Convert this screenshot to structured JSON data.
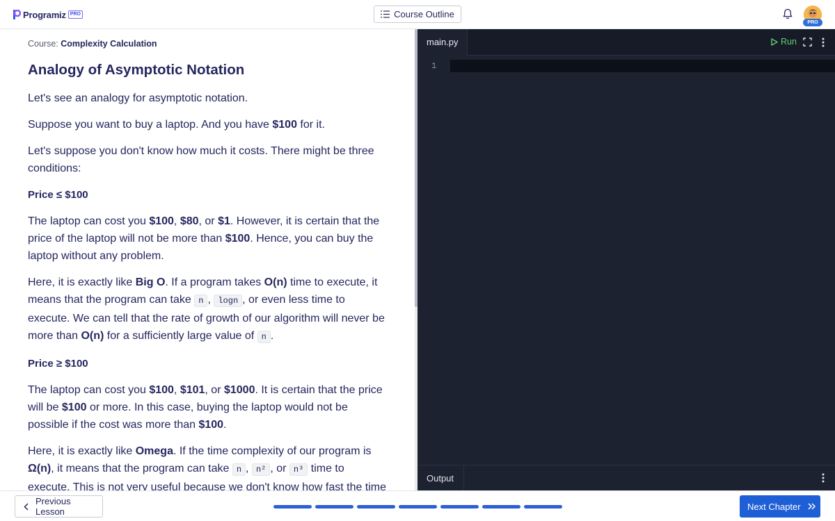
{
  "header": {
    "logo_text": "Programiz",
    "logo_badge": "PRO",
    "outline_label": "Course Outline",
    "avatar_badge": "PRO"
  },
  "lesson": {
    "course_prefix": "Course: ",
    "course_name": "Complexity Calculation",
    "title": "Analogy of Asymptotic Notation",
    "p1": "Let's see an analogy for asymptotic notation.",
    "p2_a": "Suppose you want to buy a laptop. And you have ",
    "p2_b": "$100",
    "p2_c": " for it.",
    "p3": "Let's suppose you don't know how much it costs. There might be three conditions:",
    "h_le": "Price ≤ $100",
    "p4": {
      "a": "The laptop can cost you ",
      "b": "$100",
      "c": ", ",
      "d": "$80",
      "e": ", or ",
      "f": "$1",
      "g": ". However, it is certain that the price of the laptop will not be more than ",
      "h": "$100",
      "i": ". Hence, you can buy the laptop without any problem."
    },
    "p5": {
      "a": "Here, it is exactly like ",
      "b": "Big O",
      "c": ". If a program takes ",
      "d": "O(n)",
      "e": " time to execute, it means that the program can take ",
      "code1": "n",
      "f": ", ",
      "code2": "logn",
      "g": ", or even less time to execute. We can tell that the rate of growth of our algorithm will never be more than ",
      "h": "O(n)",
      "i": " for a sufficiently large value of ",
      "code3": "n",
      "j": "."
    },
    "h_ge": "Price ≥ $100",
    "p6": {
      "a": "The laptop can cost you ",
      "b": "$100",
      "c": ", ",
      "d": "$101",
      "e": ", or ",
      "f": "$1000",
      "g": ". It is certain that the price will be ",
      "h": "$100",
      "i": " or more. In this case, buying the laptop would not be possible if the cost was more than ",
      "j": "$100",
      "k": "."
    },
    "p7": {
      "a": "Here, it is exactly like ",
      "b": "Omega",
      "c": ". If the time complexity of our program is ",
      "d": "Ω(n)",
      "e": ", it means that the program can take ",
      "code1": "n",
      "f": ", ",
      "code2": "n²",
      "g": ", or ",
      "code3": "n³",
      "h": " time to execute. This is not very useful because we don't know how fast the time"
    }
  },
  "editor": {
    "tab_label": "main.py",
    "run_label": "Run",
    "line_number": "1",
    "output_label": "Output"
  },
  "footer": {
    "prev_label": "Previous Lesson",
    "next_label": "Next Chapter",
    "progress_segments": 7,
    "progress_completed": 7
  },
  "colors": {
    "accent": "#1f5fd6",
    "run_green": "#5fd06e",
    "editor_bg": "#1c2230",
    "text": "#25265e"
  }
}
